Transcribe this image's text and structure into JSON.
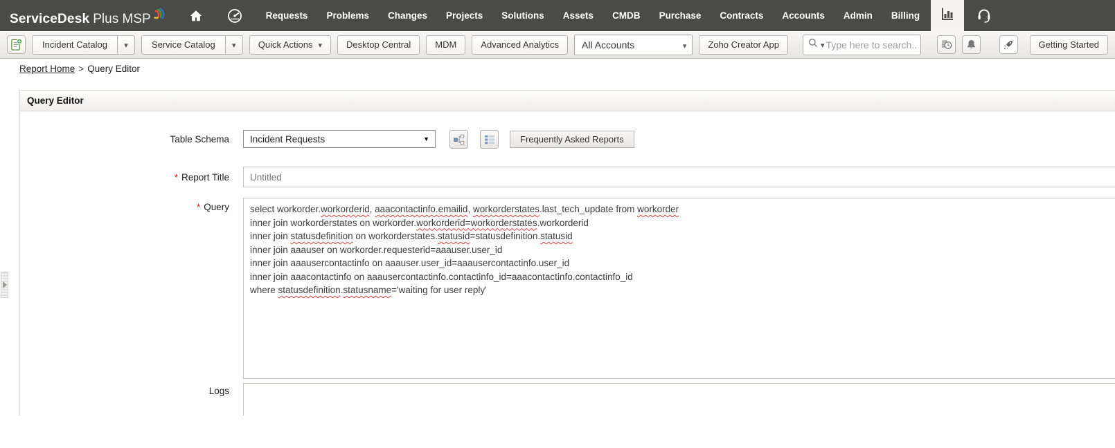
{
  "topnav": {
    "logo": {
      "bold": "ServiceDesk",
      "light": "Plus MSP"
    },
    "items": [
      "Requests",
      "Problems",
      "Changes",
      "Projects",
      "Solutions",
      "Assets",
      "CMDB",
      "Purchase",
      "Contracts",
      "Accounts",
      "Admin",
      "Billing"
    ],
    "colors": {
      "bg": "#4a4a46",
      "active_tab_bg": "#f5f4f1",
      "text": "#ffffff"
    }
  },
  "toolbar": {
    "incident_catalog": "Incident Catalog",
    "service_catalog": "Service Catalog",
    "quick_actions": "Quick Actions",
    "desktop_central": "Desktop Central",
    "mdm": "MDM",
    "advanced_analytics": "Advanced Analytics",
    "accounts_filter_value": "All Accounts",
    "zoho_creator": "Zoho Creator App",
    "search_placeholder": "Type here to search...",
    "getting_started": "Getting Started"
  },
  "breadcrumb": {
    "home": "Report Home",
    "separator": ">",
    "current": "Query Editor"
  },
  "panel": {
    "title": "Query Editor",
    "table_schema_label": "Table Schema",
    "table_schema_value": "Incident Requests",
    "faq_button": "Frequently Asked Reports",
    "report_title_label": "Report Title",
    "report_title_value": "Untitled",
    "query_label": "Query",
    "logs_label": "Logs",
    "required_marker": "*",
    "colors": {
      "required": "#cc0000",
      "spellcheck_squiggle": "#e04040"
    }
  },
  "query": {
    "lines": [
      [
        {
          "t": "select workorder."
        },
        {
          "t": "workorderid",
          "u": true
        },
        {
          "t": ", "
        },
        {
          "t": "aaacontactinfo.emailid",
          "u": true
        },
        {
          "t": ", "
        },
        {
          "t": "workorderstates",
          "u": true
        },
        {
          "t": ".last_tech_update from "
        },
        {
          "t": "workorder",
          "u": true
        }
      ],
      [
        {
          "t": "inner join workorderstates on workorder."
        },
        {
          "t": "workorderid=workorderstates",
          "u": true
        },
        {
          "t": ".workorderid"
        }
      ],
      [
        {
          "t": "inner join "
        },
        {
          "t": "statusdefinition",
          "u": true
        },
        {
          "t": " on workorderstates."
        },
        {
          "t": "statusid",
          "u": true
        },
        {
          "t": "=statusdefinition."
        },
        {
          "t": "statusid",
          "u": true
        }
      ],
      [
        {
          "t": "inner join aaauser on workorder.requesterid=aaauser.user_id"
        }
      ],
      [
        {
          "t": "inner join aaausercontactinfo on aaauser.user_id=aaausercontactinfo.user_id"
        }
      ],
      [
        {
          "t": "inner join aaacontactinfo on aaausercontactinfo.contactinfo_id=aaacontactinfo.contactinfo_id"
        }
      ],
      [
        {
          "t": "where "
        },
        {
          "t": "statusdefinition",
          "u": true
        },
        {
          "t": "."
        },
        {
          "t": "statusname",
          "u": true
        },
        {
          "t": "='waiting for user reply'"
        }
      ]
    ]
  },
  "icons": {
    "home": "home-icon",
    "dashboard": "gauge-icon",
    "reports_tab": "bar-chart-icon",
    "support": "headset-icon",
    "new_request": "new-request-icon",
    "schema_tree": "schema-tree-icon",
    "table_list": "table-list-icon",
    "search": "search-icon",
    "recent": "recent-history-icon",
    "alerts": "bell-icon",
    "launch": "rocket-icon",
    "expand": "expand-sidebar-icon"
  }
}
